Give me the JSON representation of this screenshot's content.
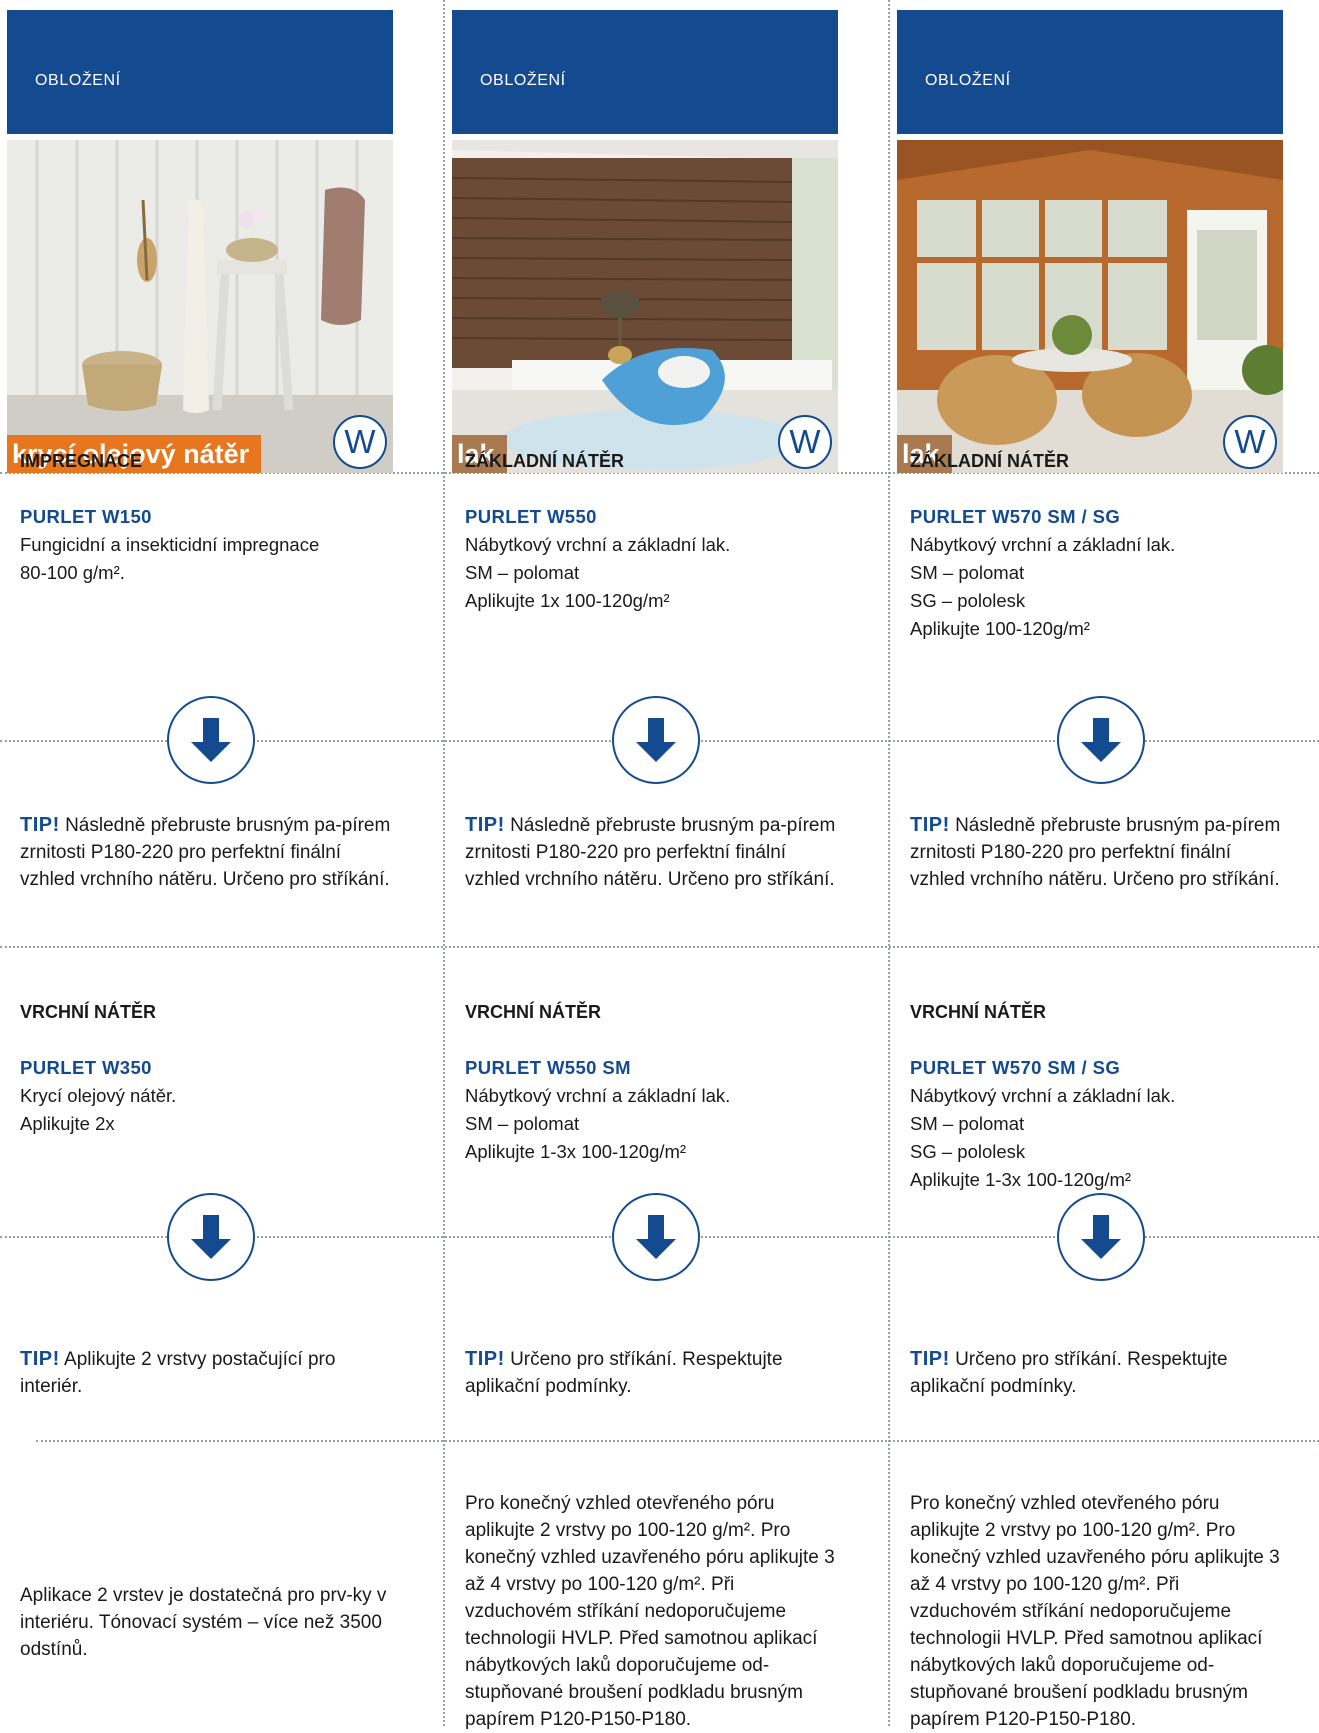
{
  "columns": [
    {
      "header": "OBLOŽENÍ",
      "badge": "krycí olejový nátěr",
      "badge_color": "#e8761f",
      "w_label": "W",
      "step1": {
        "title": "IMPREGNACE",
        "product": "PURLET W150",
        "lines": [
          "Fungicidní a insekticidní impregnace",
          "80-100 g/m²."
        ]
      },
      "tip1_label": "TIP!",
      "tip1_text": "Následně přebruste brusným pa-pírem zrnitosti P180-220 pro perfektní finální vzhled vrchního nátěru. Určeno pro stříkání.",
      "step2": {
        "title": "VRCHNÍ NÁTĚR",
        "product": "PURLET W350",
        "lines": [
          "Krycí olejový nátěr.",
          "Aplikujte 2x"
        ]
      },
      "tip2_label": "TIP!",
      "tip2_text": "Aplikujte 2 vrstvy postačující pro interiér.",
      "note": "Aplikace 2 vrstev je dostatečná pro prv-ky v interiéru. Tónovací systém – více než 3500 odstínů."
    },
    {
      "header": "OBLOŽENÍ",
      "badge": "lak",
      "badge_color": "#a97a4f",
      "w_label": "W",
      "step1": {
        "title": "ZÁKLADNÍ NÁTĚR",
        "product": "PURLET W550",
        "lines": [
          "Nábytkový vrchní a základní lak.",
          "SM – polomat",
          "Aplikujte 1x 100-120g/m²"
        ]
      },
      "tip1_label": "TIP!",
      "tip1_text": "Následně přebruste brusným pa-pírem zrnitosti P180-220 pro perfektní finální vzhled vrchního nátěru. Určeno pro stříkání.",
      "step2": {
        "title": "VRCHNÍ NÁTĚR",
        "product": "PURLET W550 SM",
        "lines": [
          "Nábytkový vrchní a základní lak.",
          "SM – polomat",
          "Aplikujte 1-3x 100-120g/m²"
        ]
      },
      "tip2_label": "TIP!",
      "tip2_text": "Určeno pro stříkání. Respektujte aplikační podmínky.",
      "note": "Pro konečný vzhled otevřeného póru aplikujte 2 vrstvy po 100-120 g/m². Pro konečný vzhled uzavřeného póru aplikujte 3 až 4 vrstvy po 100-120 g/m². Při vzduchovém stříkání nedoporučujeme technologii HVLP. Před samotnou aplikací nábytkových laků doporučujeme od-stupňované broušení podkladu brusným papírem P120-P150-P180."
    },
    {
      "header": "OBLOŽENÍ",
      "badge": "lak",
      "badge_color": "#a97a4f",
      "w_label": "W",
      "step1": {
        "title": "ZÁKLADNÍ NÁTĚR",
        "product": "PURLET W570 SM / SG",
        "lines": [
          "Nábytkový vrchní a základní lak.",
          "SM – polomat",
          "SG – pololesk",
          "Aplikujte 100-120g/m²"
        ]
      },
      "tip1_label": "TIP!",
      "tip1_text": "Následně přebruste brusným pa-pírem zrnitosti P180-220 pro perfektní finální vzhled vrchního nátěru. Určeno pro stříkání.",
      "step2": {
        "title": "VRCHNÍ NÁTĚR",
        "product": "PURLET W570 SM / SG",
        "lines": [
          "Nábytkový vrchní a základní lak.",
          "SM – polomat",
          "SG – pololesk",
          "Aplikujte 1-3x 100-120g/m²"
        ]
      },
      "tip2_label": "TIP!",
      "tip2_text": "Určeno pro stříkání. Respektujte aplikační podmínky.",
      "note": "Pro konečný vzhled otevřeného póru aplikujte 2 vrstvy po 100-120 g/m². Pro konečný vzhled uzavřeného póru aplikujte 3 až 4 vrstvy po 100-120 g/m². Při vzduchovém stříkání nedoporučujeme technologii HVLP. Před samotnou aplikací nábytkových laků doporučujeme od-stupňované broušení podkladu brusným papírem P120-P150-P180."
    }
  ],
  "icons": {
    "step_arrow": "arrow-down-icon"
  },
  "colors": {
    "brand_blue": "#144a90",
    "orange": "#e8761f",
    "brown": "#a97a4f"
  }
}
